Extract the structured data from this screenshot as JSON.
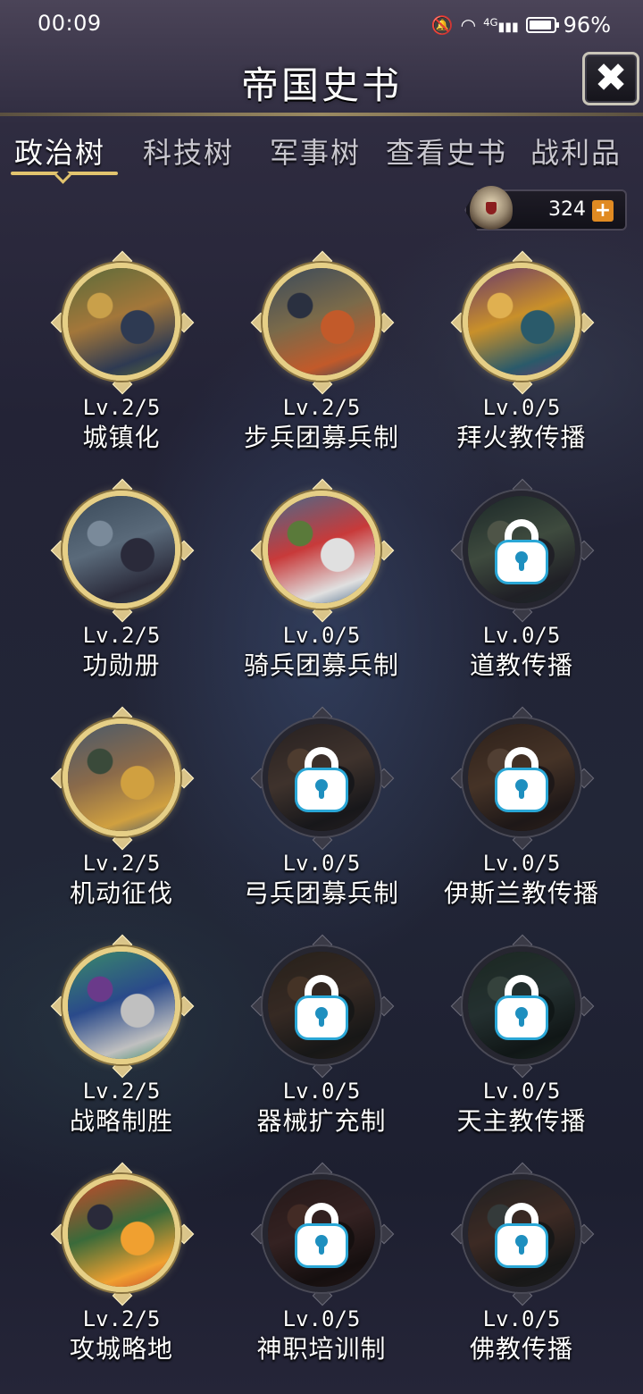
{
  "status_bar": {
    "time": "00:09",
    "network": "4G",
    "battery": "96%"
  },
  "header": {
    "title": "帝国史书"
  },
  "tabs": [
    {
      "label": "政治树",
      "active": true
    },
    {
      "label": "科技树",
      "active": false
    },
    {
      "label": "军事树",
      "active": false
    },
    {
      "label": "查看史书",
      "active": false
    },
    {
      "label": "战利品",
      "active": false
    }
  ],
  "currency": {
    "value": "324"
  },
  "nodes": [
    {
      "level": "Lv.2/5",
      "name": "城镇化",
      "locked": false
    },
    {
      "level": "Lv.2/5",
      "name": "步兵团募兵制",
      "locked": false
    },
    {
      "level": "Lv.0/5",
      "name": "拜火教传播",
      "locked": false
    },
    {
      "level": "Lv.2/5",
      "name": "功勋册",
      "locked": false
    },
    {
      "level": "Lv.0/5",
      "name": "骑兵团募兵制",
      "locked": false
    },
    {
      "level": "Lv.0/5",
      "name": "道教传播",
      "locked": true
    },
    {
      "level": "Lv.2/5",
      "name": "机动征伐",
      "locked": false
    },
    {
      "level": "Lv.0/5",
      "name": "弓兵团募兵制",
      "locked": true
    },
    {
      "level": "Lv.0/5",
      "name": "伊斯兰教传播",
      "locked": true
    },
    {
      "level": "Lv.2/5",
      "name": "战略制胜",
      "locked": false
    },
    {
      "level": "Lv.0/5",
      "name": "器械扩充制",
      "locked": true
    },
    {
      "level": "Lv.0/5",
      "name": "天主教传播",
      "locked": true
    },
    {
      "level": "Lv.2/5",
      "name": "攻城略地",
      "locked": false
    },
    {
      "level": "Lv.0/5",
      "name": "神职培训制",
      "locked": true
    },
    {
      "level": "Lv.0/5",
      "name": "佛教传播",
      "locked": true
    }
  ],
  "colors": {
    "gold_ring": "#e6cf86",
    "lock_blue": "#2aa7d6",
    "plus_orange": "#e08a22"
  }
}
